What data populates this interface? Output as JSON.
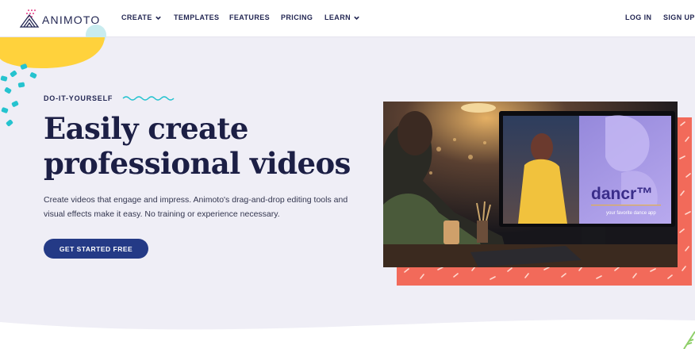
{
  "nav": {
    "logo_text": "ANIMOTO",
    "items": [
      {
        "label": "CREATE",
        "dropdown": true
      },
      {
        "label": "TEMPLATES",
        "dropdown": false
      },
      {
        "label": "FEATURES",
        "dropdown": false
      },
      {
        "label": "PRICING",
        "dropdown": false
      },
      {
        "label": "LEARN",
        "dropdown": true
      }
    ],
    "login": "LOG IN",
    "signup": "SIGN UP"
  },
  "hero": {
    "eyebrow": "DO-IT-YOURSELF",
    "headline_line1": "Easily create",
    "headline_line2": "professional videos",
    "description": "Create videos that engage and impress. Animoto's drag-and-drop editing tools and visual effects make it easy. No training or experience necessary.",
    "cta": "GET STARTED FREE"
  },
  "screen": {
    "brand": "dancr™",
    "tagline": "your favorite dance app"
  },
  "colors": {
    "navy": "#232753",
    "button": "#243a86",
    "coral": "#f26a5a",
    "yellow": "#ffd23c",
    "teal": "#25c3cf",
    "background": "#efeef6"
  },
  "icons": [
    "animoto-logo-icon",
    "chevron-down-icon",
    "squiggle-icon"
  ]
}
